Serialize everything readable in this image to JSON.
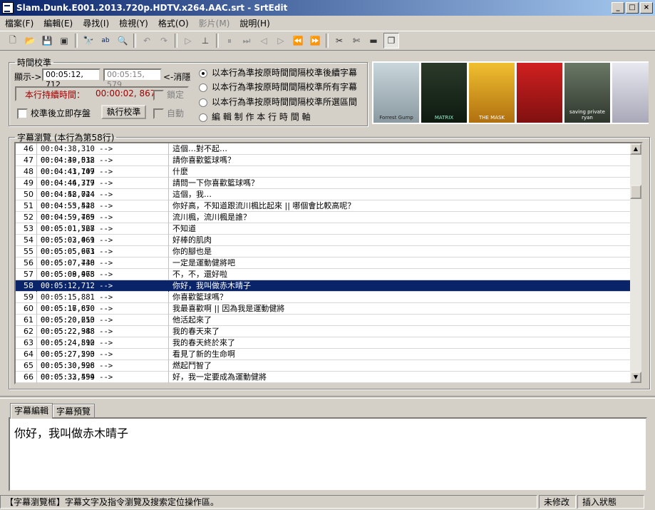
{
  "window": {
    "title": "Slam.Dunk.E001.2013.720p.HDTV.x264.AAC.srt - SrtEdit",
    "minimize": "_",
    "maximize": "□",
    "close": "×"
  },
  "menu": [
    "檔案(F)",
    "編輯(E)",
    "尋找(I)",
    "檢視(Y)",
    "格式(O)",
    "影片(M)",
    "說明(H)"
  ],
  "menu_disabled": "影片(M)",
  "toolbar": {
    "icons": [
      "new-file-icon",
      "open-folder-icon",
      "save-icon",
      "save-all-icon",
      "find-icon",
      "replace-icon",
      "zoom-icon",
      "undo-icon",
      "redo-icon",
      "play-icon",
      "sync-icon",
      "pause-icon",
      "step-icon",
      "prev-icon",
      "next-icon",
      "rewind-icon",
      "forward-icon",
      "tools-icon",
      "tools2-icon",
      "film-icon",
      "panel-icon"
    ]
  },
  "timing": {
    "group_title": "時間校準",
    "display_label": "顯示->",
    "display_value": "00:05:12, 712",
    "original_value": "00:05:15, 579",
    "cancel_label": "<-消隱",
    "duration_label": "本行持續時間：",
    "duration_value": "00:00:02, 867",
    "lock_label": "鎖定",
    "save_after_label": "校準後立即存盤",
    "execute_button": "執行校準",
    "auto_label": "自動",
    "options": [
      "以本行為準按原時間間隔校準後續字幕",
      "以本行為準按原時間間隔校準所有字幕",
      "以本行為準按原時間間隔校準所選區間",
      "編 輯 制 作 本 行 時 間 軸"
    ],
    "selected_option": 0
  },
  "posters": [
    {
      "label": "Forrest Gump",
      "color": "#9aa7ad"
    },
    {
      "label": "MATRIX",
      "color": "#1f3322"
    },
    {
      "label": "THE MASK",
      "color": "#d8a020"
    },
    {
      "label": "",
      "color": "#b81818"
    },
    {
      "label": "saving private ryan",
      "color": "#4e5a4a"
    },
    {
      "label": "",
      "color": "#d8d8e0"
    }
  ],
  "list": {
    "group_title": "字幕瀏覽 (本行為第58行)",
    "selected_index": 12,
    "rows": [
      {
        "n": "46",
        "t": "00:04:38,310 --> 00:04:39,538",
        "s": "這個…對不起…"
      },
      {
        "n": "47",
        "t": "00:04:40,012 --> 00:04:41,707",
        "s": "請你喜歡籃球嗎？"
      },
      {
        "n": "48",
        "t": "00:04:43,149 --> 00:04:44,377",
        "s": "什麼"
      },
      {
        "n": "49",
        "t": "00:04:46,719 --> 00:04:48,744",
        "s": "請問一下你喜歡籃球嗎？"
      },
      {
        "n": "50",
        "t": "00:04:52,024 --> 00:04:53,548",
        "s": "這個，我…"
      },
      {
        "n": "51",
        "t": "00:04:55,428 --> 00:04:59,489",
        "s": "你好高，不知道跟流川楓比起來 || 哪個會比較高呢？"
      },
      {
        "n": "52",
        "t": "00:04:59,765 --> 00:05:01,528",
        "s": "流川楓，流川楓是誰？"
      },
      {
        "n": "53",
        "t": "00:05:01,767 --> 00:05:02,461",
        "s": "不知道"
      },
      {
        "n": "54",
        "t": "00:05:03,069 --> 00:05:05,663",
        "s": "好棒的肌肉"
      },
      {
        "n": "55",
        "t": "00:05:05,971 --> 00:05:07,438",
        "s": "你的腳也是"
      },
      {
        "n": "56",
        "t": "00:05:07,740 --> 00:05:08,968",
        "s": "一定是運動健將吧"
      },
      {
        "n": "57",
        "t": "00:05:09,475 --> 00:05:10,908",
        "s": "不，不，還好啦"
      },
      {
        "n": "58",
        "t": "00:05:12,712 --> 00:05:15,579",
        "s": "你好，我叫做赤木晴子"
      },
      {
        "n": "59",
        "t": "00:05:15,881 --> 00:05:16,870",
        "s": "你喜歡籃球嗎？"
      },
      {
        "n": "60",
        "t": "00:05:17,650 --> 00:05:20,210",
        "s": "我最喜歡啊 || 因為我是運動健將"
      },
      {
        "n": "61",
        "t": "00:05:20,653 --> 00:05:22,348",
        "s": "他活起來了"
      },
      {
        "n": "62",
        "t": "00:05:22,988 --> 00:05:24,512",
        "s": "我的春天來了"
      },
      {
        "n": "63",
        "t": "00:05:24,890 --> 00:05:27,290",
        "s": "我的春天終於來了"
      },
      {
        "n": "64",
        "t": "00:05:27,593 --> 00:05:30,528",
        "s": "看見了新的生命啊"
      },
      {
        "n": "65",
        "t": "00:05:30,996 --> 00:05:32,554",
        "s": "燃起鬥智了"
      },
      {
        "n": "66",
        "t": "00:05:33,499 --> 00:05:36,400",
        "s": "好，我一定要成為運動健將"
      }
    ]
  },
  "editor": {
    "tabs": [
      "字幕編輯",
      "字幕預覽"
    ],
    "active_tab": 0,
    "text": "你好，我叫做赤木晴子"
  },
  "status": {
    "hint": "【字幕瀏覽框】字幕文字及指令瀏覽及搜索定位操作區。",
    "modified": "未修改",
    "mode": "插入狀態"
  }
}
